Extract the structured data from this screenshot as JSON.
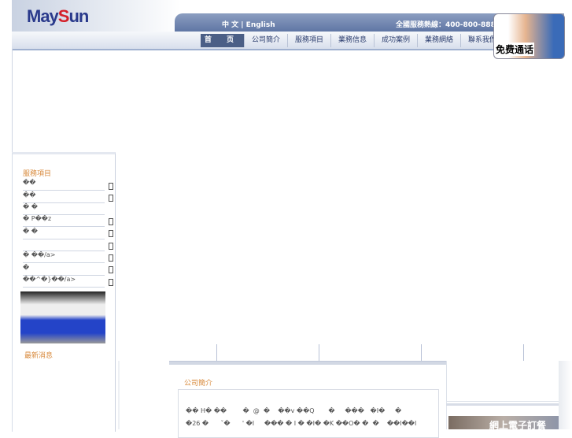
{
  "header": {
    "logo_text": "MaySun",
    "lang": "中 文 | English",
    "hotline": "全國服務熱線：400-800-888"
  },
  "nav": [
    {
      "label": "首 页",
      "active": true
    },
    {
      "label": "公司簡介"
    },
    {
      "label": "服務項目"
    },
    {
      "label": "業務信息"
    },
    {
      "label": "成功案例"
    },
    {
      "label": "業務網絡"
    },
    {
      "label": "聯系我們"
    }
  ],
  "call": {
    "label": "免费通话"
  },
  "sidebar": {
    "title": "服務項目",
    "items": [
      "��",
      "��",
      "� �",
      "� P��z",
      "� �",
      "",
      "�   ��/a>",
      "�",
      "��^�}��/a>"
    ],
    "news_title": "最新消息"
  },
  "content": {
    "title": "公司簡介",
    "lines": [
      "�� H� ��        �  @  �    ��v ��Q       �     ���   �I�     �",
      "�26 �      ˇ�      ' �I     ��� � I � �I� �K ��O� �  �    ��I��I"
    ]
  },
  "banner": {
    "text": "網上電子訂餐"
  }
}
